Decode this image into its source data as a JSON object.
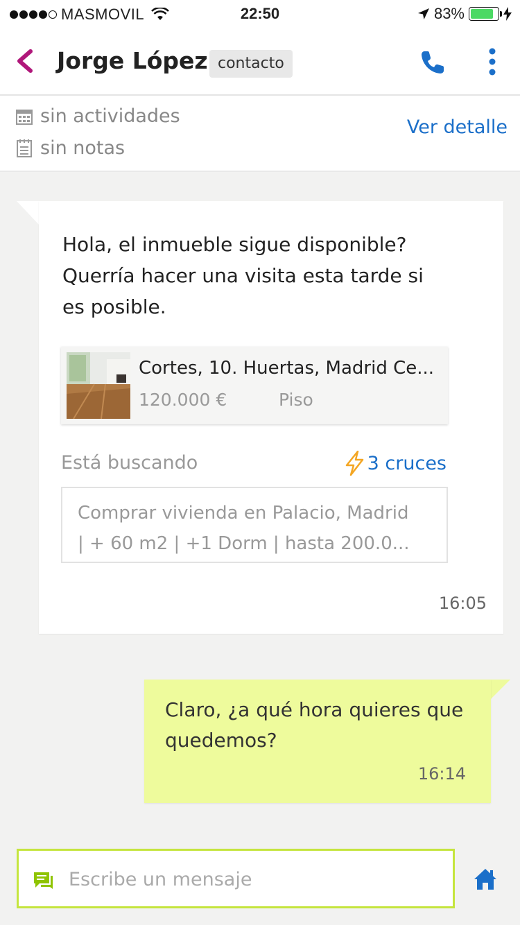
{
  "status_bar": {
    "carrier": "MASMOVIL",
    "time": "22:50",
    "battery": "83%",
    "battery_level": 0.83
  },
  "header": {
    "contact_name": "Jorge López",
    "badge": "contacto",
    "icons": [
      "back-chevron-icon",
      "phone-icon",
      "more-vertical-icon"
    ]
  },
  "info": {
    "activities": "sin actividades",
    "notes": "sin notas",
    "detail_link": "Ver detalle",
    "icons": [
      "calendar-icon",
      "notes-icon"
    ]
  },
  "incoming": {
    "text": "Hola, el inmueble sigue disponible? Querría hacer una visita esta tarde si es posible.",
    "property": {
      "address": "Cortes, 10. Huertas, Madrid Ce...",
      "price": "120.000 €",
      "type": "Piso"
    },
    "searching_label": "Está buscando",
    "matches": "3 cruces",
    "search_line1": "Comprar vivienda en Palacio, Madrid",
    "search_line2": "| + 60 m2 | +1 Dorm | hasta 200.0...",
    "time": "16:05"
  },
  "outgoing": {
    "text": "Claro, ¿a qué hora quieres que quedemos?",
    "time": "16:14"
  },
  "composer": {
    "placeholder": "Escribe un mensaje",
    "icons": [
      "chat-icon",
      "home-icon"
    ]
  },
  "colors": {
    "accent_purple": "#b0177a",
    "link_blue": "#1b6fc9",
    "bubble_out": "#eefb9c",
    "composer_border": "#c5e53e"
  }
}
